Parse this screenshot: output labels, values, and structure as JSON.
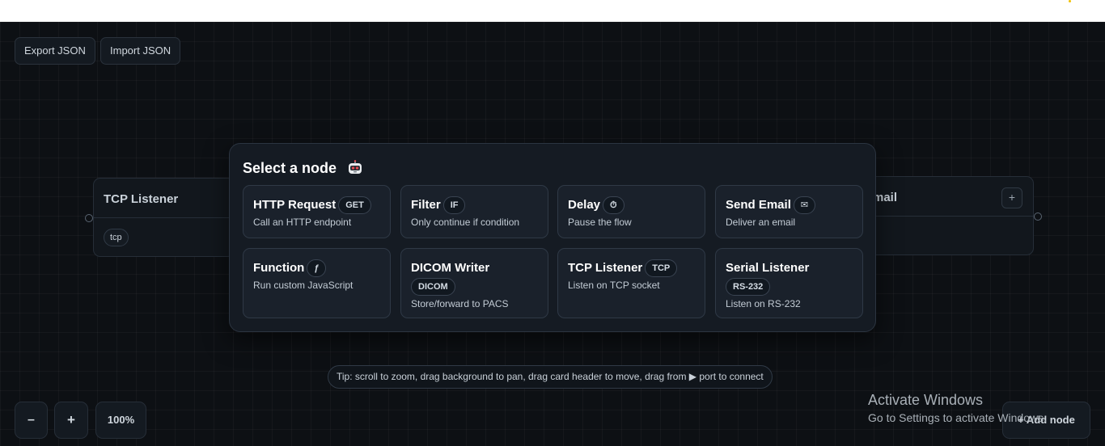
{
  "toolbar": {
    "export_label": "Export JSON",
    "import_label": "Import JSON"
  },
  "canvas_cards": [
    {
      "title": "TCP Listener",
      "tag": "tcp"
    },
    {
      "title": "mail",
      "action": "+"
    }
  ],
  "modal": {
    "title": "Select a node",
    "emoji": "robot-face-icon",
    "nodes": [
      {
        "name": "HTTP Request",
        "badge": "GET",
        "description": "Call an HTTP endpoint"
      },
      {
        "name": "Filter",
        "badge": "IF",
        "description": "Only continue if condition"
      },
      {
        "name": "Delay",
        "badge": "⏱",
        "description": "Pause the flow"
      },
      {
        "name": "Send Email",
        "badge": "✉",
        "description": "Deliver an email"
      },
      {
        "name": "Function",
        "badge": "ƒ",
        "description": "Run custom JavaScript"
      },
      {
        "name": "DICOM Writer",
        "badge": "DICOM",
        "description": "Store/forward to PACS"
      },
      {
        "name": "TCP Listener",
        "badge": "TCP",
        "description": "Listen on TCP socket"
      },
      {
        "name": "Serial Listener",
        "badge": "RS-232",
        "description": "Listen on RS-232"
      }
    ]
  },
  "tip": {
    "before": "Tip: scroll to zoom, drag background to pan, drag card header to move, drag from",
    "arrow": "▶",
    "after": "port to connect"
  },
  "zoom": {
    "minus": "–",
    "plus": "+",
    "level": "100%"
  },
  "add_node_label": "Add node",
  "add_node_icon": "+",
  "watermark": {
    "title": "Activate Windows",
    "subtitle": "Go to Settings to activate Windows."
  },
  "colors": {
    "canvas_bg": "#0d1014",
    "modal_bg": "#151b23",
    "node_bg": "#1a212b",
    "border": "#2f3946"
  }
}
